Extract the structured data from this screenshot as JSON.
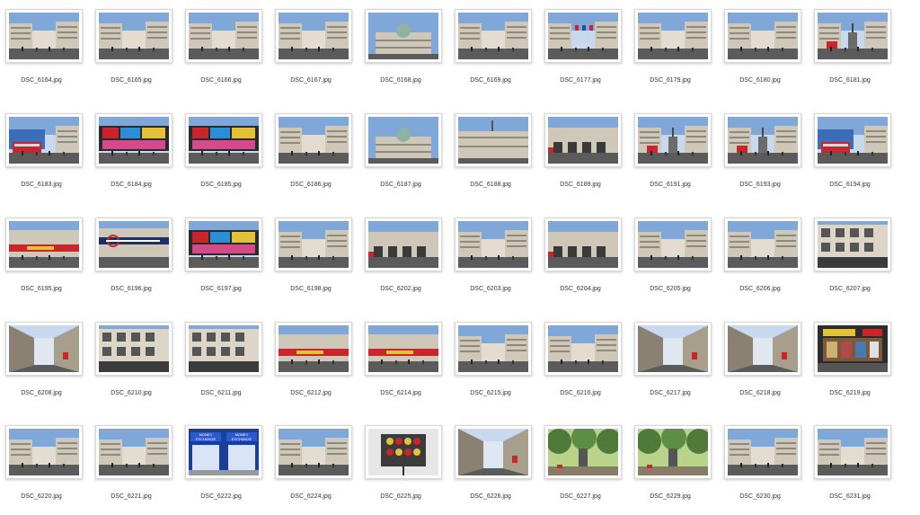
{
  "files": [
    {
      "name": "DSC_6164.jpg",
      "scene": "street"
    },
    {
      "name": "DSC_6165.jpg",
      "scene": "street"
    },
    {
      "name": "DSC_6166.jpg",
      "scene": "street"
    },
    {
      "name": "DSC_6167.jpg",
      "scene": "street"
    },
    {
      "name": "DSC_6168.jpg",
      "scene": "dome"
    },
    {
      "name": "DSC_6169.jpg",
      "scene": "street"
    },
    {
      "name": "DSC_6177.jpg",
      "scene": "flags"
    },
    {
      "name": "DSC_6179.jpg",
      "scene": "street"
    },
    {
      "name": "DSC_6180.jpg",
      "scene": "street"
    },
    {
      "name": "DSC_6181.jpg",
      "scene": "statue"
    },
    {
      "name": "DSC_6183.jpg",
      "scene": "bus"
    },
    {
      "name": "DSC_6184.jpg",
      "scene": "billboard"
    },
    {
      "name": "DSC_6185.jpg",
      "scene": "billboard"
    },
    {
      "name": "DSC_6186.jpg",
      "scene": "street"
    },
    {
      "name": "DSC_6187.jpg",
      "scene": "dome"
    },
    {
      "name": "DSC_6188.jpg",
      "scene": "building"
    },
    {
      "name": "DSC_6189.jpg",
      "scene": "arcade"
    },
    {
      "name": "DSC_6191.jpg",
      "scene": "statue"
    },
    {
      "name": "DSC_6193.jpg",
      "scene": "statue"
    },
    {
      "name": "DSC_6194.jpg",
      "scene": "bus"
    },
    {
      "name": "DSC_6195.jpg",
      "scene": "shop"
    },
    {
      "name": "DSC_6196.jpg",
      "scene": "underground"
    },
    {
      "name": "DSC_6197.jpg",
      "scene": "billboard"
    },
    {
      "name": "DSC_6198.jpg",
      "scene": "street"
    },
    {
      "name": "DSC_6202.jpg",
      "scene": "arcade"
    },
    {
      "name": "DSC_6203.jpg",
      "scene": "street"
    },
    {
      "name": "DSC_6204.jpg",
      "scene": "arcade"
    },
    {
      "name": "DSC_6205.jpg",
      "scene": "street"
    },
    {
      "name": "DSC_6206.jpg",
      "scene": "street"
    },
    {
      "name": "DSC_6207.jpg",
      "scene": "facade"
    },
    {
      "name": "DSC_6208.jpg",
      "scene": "alley"
    },
    {
      "name": "DSC_6210.jpg",
      "scene": "facade"
    },
    {
      "name": "DSC_6211.jpg",
      "scene": "facade"
    },
    {
      "name": "DSC_6212.jpg",
      "scene": "shop"
    },
    {
      "name": "DSC_6214.jpg",
      "scene": "shop"
    },
    {
      "name": "DSC_6215.jpg",
      "scene": "street"
    },
    {
      "name": "DSC_6216.jpg",
      "scene": "street"
    },
    {
      "name": "DSC_6217.jpg",
      "scene": "alley"
    },
    {
      "name": "DSC_6218.jpg",
      "scene": "alley"
    },
    {
      "name": "DSC_6219.jpg",
      "scene": "kiosk"
    },
    {
      "name": "DSC_6220.jpg",
      "scene": "street"
    },
    {
      "name": "DSC_6221.jpg",
      "scene": "street"
    },
    {
      "name": "DSC_6222.jpg",
      "scene": "exchange",
      "signText": "MONEY EXCHANGE"
    },
    {
      "name": "DSC_6224.jpg",
      "scene": "street"
    },
    {
      "name": "DSC_6225.jpg",
      "scene": "clock"
    },
    {
      "name": "DSC_6226.jpg",
      "scene": "alley"
    },
    {
      "name": "DSC_6227.jpg",
      "scene": "trees"
    },
    {
      "name": "DSC_6229.jpg",
      "scene": "trees"
    },
    {
      "name": "DSC_6230.jpg",
      "scene": "street"
    },
    {
      "name": "DSC_6231.jpg",
      "scene": "street"
    }
  ],
  "colors": {
    "sky": "#7fa8d8",
    "skyLight": "#c8d9ee",
    "stone": "#cfc7b8",
    "stoneDark": "#8f887c",
    "road": "#5b5b5b",
    "red": "#c8262b",
    "green": "#4f7a3a",
    "blue": "#2a4fa0",
    "yellow": "#e3c23a"
  }
}
